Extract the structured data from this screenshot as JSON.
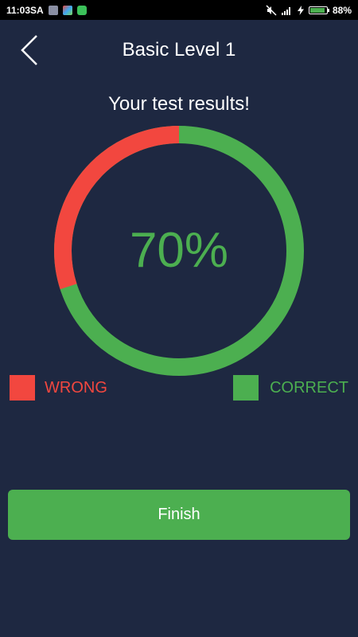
{
  "status_bar": {
    "time": "11:03SA",
    "battery": "88%",
    "battery_level": 0.88,
    "icons": [
      "image-notification-icon",
      "app-notification-icon",
      "alarm-notification-icon",
      "mute-icon",
      "signal-icon",
      "charging-icon"
    ]
  },
  "header": {
    "title": "Basic Level 1",
    "back_icon": "chevron-left-icon"
  },
  "results": {
    "heading": "Your test results!",
    "percent_label": "70%",
    "correct_fraction": 0.7,
    "wrong_fraction": 0.3
  },
  "legend": {
    "wrong_label": "WRONG",
    "correct_label": "CORRECT"
  },
  "actions": {
    "finish_label": "Finish"
  },
  "colors": {
    "background": "#1e2841",
    "wrong": "#f2473f",
    "correct": "#4caf50",
    "button": "#4caf50"
  }
}
